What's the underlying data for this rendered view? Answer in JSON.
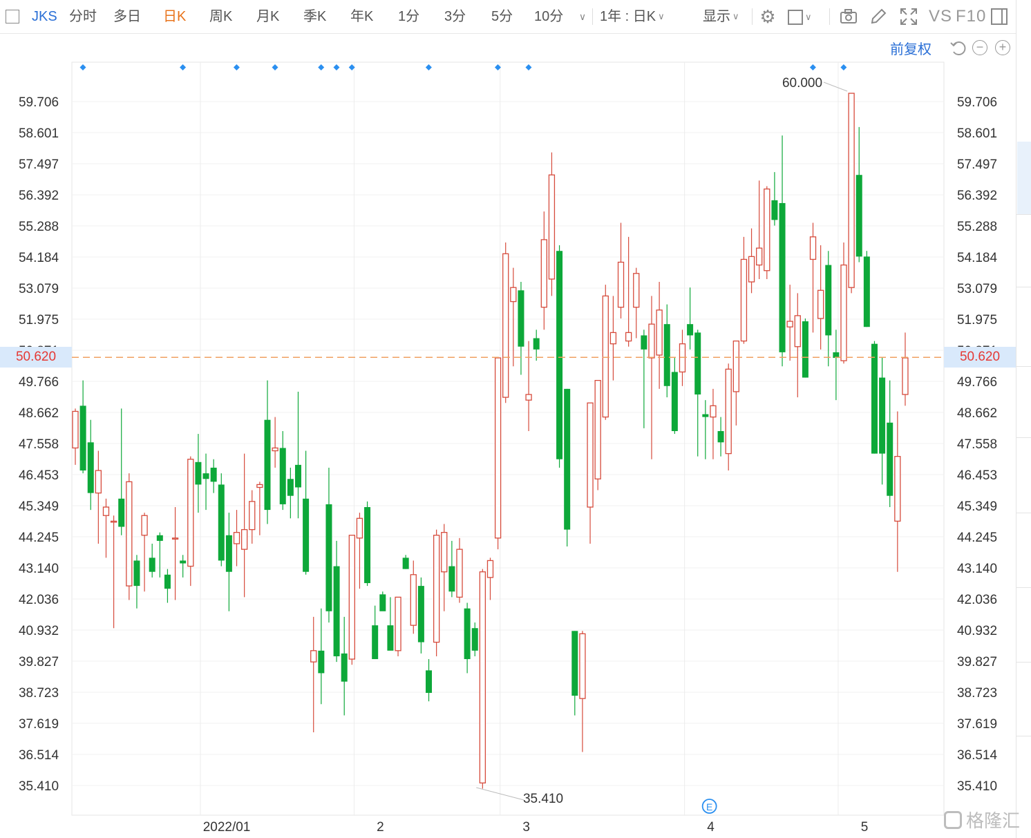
{
  "toolbar": {
    "symbol": "JKS",
    "periods": [
      "分时",
      "多日",
      "日K",
      "周K",
      "月K",
      "季K",
      "年K",
      "1分",
      "3分",
      "5分",
      "10分"
    ],
    "active_period": "日K",
    "range_label": "1年 : 日K",
    "display_label": "显示",
    "vs_label": "VS",
    "f10_label": "F10"
  },
  "subbar": {
    "adjust_label": "前复权"
  },
  "price_axis": {
    "ticks": [
      "59.706",
      "58.601",
      "57.497",
      "56.392",
      "55.288",
      "54.184",
      "53.079",
      "51.975",
      "50.871",
      "49.766",
      "48.662",
      "47.558",
      "46.453",
      "45.349",
      "44.245",
      "43.140",
      "42.036",
      "40.932",
      "39.827",
      "38.723",
      "37.619",
      "36.514",
      "35.410"
    ],
    "current_price": "50.620"
  },
  "time_axis": {
    "labels": [
      "2022/01",
      "2",
      "3",
      "4",
      "5"
    ]
  },
  "annotations": {
    "high_label": "60.000",
    "low_label": "35.410",
    "earnings_marker": "E"
  },
  "watermark": "格隆汇",
  "colors": {
    "up": "#d64a3b",
    "down": "#0da839",
    "accent": "#2a6fd6",
    "active": "#e8731a",
    "current_line": "#f0a060",
    "current_text": "#e53935"
  },
  "chart_data": {
    "type": "candlestick",
    "symbol": "JKS",
    "period": "daily",
    "candles": [
      {
        "o": 47.4,
        "h": 48.8,
        "l": 46.8,
        "c": 48.7
      },
      {
        "o": 48.9,
        "h": 49.8,
        "l": 46.5,
        "c": 46.6
      },
      {
        "o": 47.6,
        "h": 48.4,
        "l": 45.2,
        "c": 45.8
      },
      {
        "o": 45.8,
        "h": 47.3,
        "l": 44.0,
        "c": 46.6
      },
      {
        "o": 45.0,
        "h": 45.6,
        "l": 43.5,
        "c": 45.3
      },
      {
        "o": 44.8,
        "h": 45.0,
        "l": 41.0,
        "c": 44.8
      },
      {
        "o": 45.6,
        "h": 48.8,
        "l": 44.3,
        "c": 44.6
      },
      {
        "o": 42.5,
        "h": 46.5,
        "l": 42.0,
        "c": 46.2
      },
      {
        "o": 43.4,
        "h": 43.6,
        "l": 41.7,
        "c": 42.5
      },
      {
        "o": 44.3,
        "h": 45.1,
        "l": 42.3,
        "c": 45.0
      },
      {
        "o": 43.5,
        "h": 44.0,
        "l": 42.8,
        "c": 43.0
      },
      {
        "o": 44.3,
        "h": 44.4,
        "l": 42.8,
        "c": 44.1
      },
      {
        "o": 42.9,
        "h": 43.1,
        "l": 41.9,
        "c": 42.4
      },
      {
        "o": 44.2,
        "h": 45.3,
        "l": 42.0,
        "c": 44.2
      },
      {
        "o": 43.4,
        "h": 43.6,
        "l": 42.8,
        "c": 43.3
      },
      {
        "o": 43.2,
        "h": 47.1,
        "l": 42.5,
        "c": 47.0
      },
      {
        "o": 46.9,
        "h": 47.9,
        "l": 45.1,
        "c": 46.1
      },
      {
        "o": 46.5,
        "h": 47.2,
        "l": 45.2,
        "c": 46.3
      },
      {
        "o": 46.7,
        "h": 47.0,
        "l": 45.8,
        "c": 46.2
      },
      {
        "o": 46.1,
        "h": 46.5,
        "l": 43.2,
        "c": 43.4
      },
      {
        "o": 44.3,
        "h": 45.1,
        "l": 41.6,
        "c": 43.0
      },
      {
        "o": 44.0,
        "h": 45.2,
        "l": 43.2,
        "c": 44.4
      },
      {
        "o": 43.8,
        "h": 47.2,
        "l": 42.1,
        "c": 44.5
      },
      {
        "o": 44.5,
        "h": 45.9,
        "l": 44.0,
        "c": 45.5
      },
      {
        "o": 46.0,
        "h": 46.2,
        "l": 44.3,
        "c": 46.1
      },
      {
        "o": 48.4,
        "h": 49.8,
        "l": 44.7,
        "c": 45.2
      },
      {
        "o": 47.3,
        "h": 48.5,
        "l": 46.7,
        "c": 47.4
      },
      {
        "o": 47.4,
        "h": 48.0,
        "l": 45.2,
        "c": 45.4
      },
      {
        "o": 46.3,
        "h": 46.7,
        "l": 44.9,
        "c": 45.7
      },
      {
        "o": 46.8,
        "h": 49.4,
        "l": 44.9,
        "c": 46.0
      },
      {
        "o": 45.6,
        "h": 47.3,
        "l": 42.9,
        "c": 43.0
      },
      {
        "o": 39.8,
        "h": 41.4,
        "l": 37.3,
        "c": 40.2
      },
      {
        "o": 40.2,
        "h": 41.7,
        "l": 38.3,
        "c": 39.4
      },
      {
        "o": 45.4,
        "h": 46.7,
        "l": 41.2,
        "c": 41.6
      },
      {
        "o": 43.2,
        "h": 44.1,
        "l": 39.8,
        "c": 40.0
      },
      {
        "o": 40.1,
        "h": 41.4,
        "l": 37.9,
        "c": 39.1
      },
      {
        "o": 39.9,
        "h": 44.3,
        "l": 39.7,
        "c": 44.3
      },
      {
        "o": 44.2,
        "h": 45.1,
        "l": 42.4,
        "c": 44.9
      },
      {
        "o": 45.3,
        "h": 45.5,
        "l": 42.5,
        "c": 42.6
      },
      {
        "o": 41.1,
        "h": 41.8,
        "l": 39.9,
        "c": 39.9
      },
      {
        "o": 42.2,
        "h": 42.3,
        "l": 41.7,
        "c": 41.6
      },
      {
        "o": 41.1,
        "h": 42.1,
        "l": 40.3,
        "c": 40.2
      },
      {
        "o": 40.2,
        "h": 41.9,
        "l": 40.0,
        "c": 42.1
      },
      {
        "o": 43.5,
        "h": 43.6,
        "l": 43.1,
        "c": 43.1
      },
      {
        "o": 41.1,
        "h": 43.4,
        "l": 40.8,
        "c": 42.9
      },
      {
        "o": 42.5,
        "h": 42.8,
        "l": 40.1,
        "c": 40.5
      },
      {
        "o": 39.5,
        "h": 39.9,
        "l": 38.4,
        "c": 38.7
      },
      {
        "o": 40.5,
        "h": 44.5,
        "l": 40.0,
        "c": 44.3
      },
      {
        "o": 43.0,
        "h": 44.7,
        "l": 41.6,
        "c": 44.4
      },
      {
        "o": 43.2,
        "h": 44.1,
        "l": 42.1,
        "c": 42.3
      },
      {
        "o": 42.1,
        "h": 44.2,
        "l": 41.9,
        "c": 43.8
      },
      {
        "o": 41.7,
        "h": 41.9,
        "l": 39.4,
        "c": 39.9
      },
      {
        "o": 41.0,
        "h": 41.2,
        "l": 40.0,
        "c": 40.2
      },
      {
        "o": 35.5,
        "h": 43.1,
        "l": 35.3,
        "c": 43.0
      },
      {
        "o": 42.8,
        "h": 43.5,
        "l": 42.0,
        "c": 43.4
      },
      {
        "o": 44.2,
        "h": 50.6,
        "l": 43.8,
        "c": 50.6
      },
      {
        "o": 49.2,
        "h": 54.7,
        "l": 49.0,
        "c": 54.3
      },
      {
        "o": 52.6,
        "h": 53.8,
        "l": 50.3,
        "c": 53.1
      },
      {
        "o": 53.0,
        "h": 53.3,
        "l": 50.0,
        "c": 51.0
      },
      {
        "o": 49.1,
        "h": 51.2,
        "l": 48.0,
        "c": 49.3
      },
      {
        "o": 51.3,
        "h": 51.6,
        "l": 50.5,
        "c": 50.9
      },
      {
        "o": 52.4,
        "h": 55.8,
        "l": 51.6,
        "c": 54.8
      },
      {
        "o": 53.4,
        "h": 57.9,
        "l": 52.8,
        "c": 57.1
      },
      {
        "o": 54.4,
        "h": 54.6,
        "l": 46.7,
        "c": 47.0
      },
      {
        "o": 49.5,
        "h": 49.5,
        "l": 43.9,
        "c": 44.5
      },
      {
        "o": 40.9,
        "h": 40.9,
        "l": 37.9,
        "c": 38.6
      },
      {
        "o": 38.5,
        "h": 40.9,
        "l": 36.6,
        "c": 40.8
      },
      {
        "o": 45.3,
        "h": 49.0,
        "l": 44.0,
        "c": 49.0
      },
      {
        "o": 46.3,
        "h": 49.8,
        "l": 45.9,
        "c": 49.8
      },
      {
        "o": 48.5,
        "h": 53.2,
        "l": 48.4,
        "c": 52.8
      },
      {
        "o": 51.1,
        "h": 52.8,
        "l": 49.8,
        "c": 51.5
      },
      {
        "o": 52.4,
        "h": 55.4,
        "l": 52.0,
        "c": 54.0
      },
      {
        "o": 51.2,
        "h": 54.9,
        "l": 51.0,
        "c": 51.5
      },
      {
        "o": 52.4,
        "h": 53.8,
        "l": 51.3,
        "c": 53.6
      },
      {
        "o": 51.4,
        "h": 51.6,
        "l": 48.1,
        "c": 50.9
      },
      {
        "o": 50.6,
        "h": 52.8,
        "l": 47.0,
        "c": 51.8
      },
      {
        "o": 50.7,
        "h": 53.3,
        "l": 49.5,
        "c": 52.3
      },
      {
        "o": 51.8,
        "h": 52.5,
        "l": 49.2,
        "c": 49.6
      },
      {
        "o": 50.1,
        "h": 50.6,
        "l": 47.9,
        "c": 48.0
      },
      {
        "o": 50.1,
        "h": 51.6,
        "l": 49.6,
        "c": 51.1
      },
      {
        "o": 51.8,
        "h": 53.1,
        "l": 50.9,
        "c": 51.4
      },
      {
        "o": 51.5,
        "h": 51.6,
        "l": 47.1,
        "c": 49.3
      },
      {
        "o": 48.6,
        "h": 49.1,
        "l": 47.0,
        "c": 48.5
      },
      {
        "o": 48.5,
        "h": 49.5,
        "l": 47.0,
        "c": 48.9
      },
      {
        "o": 48.0,
        "h": 48.5,
        "l": 47.1,
        "c": 47.6
      },
      {
        "o": 47.2,
        "h": 50.4,
        "l": 46.6,
        "c": 50.2
      },
      {
        "o": 49.4,
        "h": 51.1,
        "l": 48.2,
        "c": 51.2
      },
      {
        "o": 51.2,
        "h": 54.9,
        "l": 51.1,
        "c": 54.1
      },
      {
        "o": 53.3,
        "h": 55.2,
        "l": 52.9,
        "c": 54.2
      },
      {
        "o": 53.9,
        "h": 56.9,
        "l": 53.4,
        "c": 54.5
      },
      {
        "o": 53.7,
        "h": 56.7,
        "l": 53.4,
        "c": 56.6
      },
      {
        "o": 56.2,
        "h": 57.2,
        "l": 55.3,
        "c": 55.5
      },
      {
        "o": 56.1,
        "h": 58.5,
        "l": 50.3,
        "c": 50.8
      },
      {
        "o": 51.7,
        "h": 53.2,
        "l": 50.5,
        "c": 51.9
      },
      {
        "o": 51.0,
        "h": 52.9,
        "l": 49.2,
        "c": 52.1
      },
      {
        "o": 51.9,
        "h": 52.0,
        "l": 49.9,
        "c": 49.9
      },
      {
        "o": 54.1,
        "h": 55.4,
        "l": 51.5,
        "c": 54.9
      },
      {
        "o": 52.0,
        "h": 54.6,
        "l": 50.9,
        "c": 53.0
      },
      {
        "o": 53.9,
        "h": 54.4,
        "l": 50.3,
        "c": 51.4
      },
      {
        "o": 50.8,
        "h": 51.6,
        "l": 49.1,
        "c": 50.6
      },
      {
        "o": 50.5,
        "h": 54.7,
        "l": 50.4,
        "c": 53.9
      },
      {
        "o": 53.1,
        "h": 60.0,
        "l": 52.9,
        "c": 60.0
      },
      {
        "o": 57.1,
        "h": 58.8,
        "l": 54.0,
        "c": 54.2
      },
      {
        "o": 54.2,
        "h": 54.4,
        "l": 51.7,
        "c": 51.7
      },
      {
        "o": 51.1,
        "h": 51.2,
        "l": 47.2,
        "c": 47.2
      },
      {
        "o": 49.9,
        "h": 50.6,
        "l": 46.1,
        "c": 47.2
      },
      {
        "o": 48.3,
        "h": 49.8,
        "l": 45.3,
        "c": 45.7
      },
      {
        "o": 44.8,
        "h": 48.7,
        "l": 43.0,
        "c": 47.1
      },
      {
        "o": 49.3,
        "h": 51.5,
        "l": 48.9,
        "c": 50.6
      }
    ],
    "events_at_index": [
      0,
      13,
      20,
      25,
      31,
      33,
      35,
      45,
      54,
      58,
      95,
      99
    ],
    "y_ticks": [
      59.706,
      58.601,
      57.497,
      56.392,
      55.288,
      54.184,
      53.079,
      51.975,
      50.871,
      49.766,
      48.662,
      47.558,
      46.453,
      45.349,
      44.245,
      43.14,
      42.036,
      40.932,
      39.827,
      38.723,
      37.619,
      36.514,
      35.41
    ],
    "x_labels": [
      {
        "label": "2022/01",
        "index": 17
      },
      {
        "label": "2",
        "index": 37
      },
      {
        "label": "3",
        "index": 56
      },
      {
        "label": "4",
        "index": 80
      },
      {
        "label": "5",
        "index": 100
      }
    ],
    "current_price": 50.62,
    "high": 60.0,
    "low": 35.41,
    "high_index": 101,
    "low_index": 52,
    "earnings_index": 72,
    "grid": true
  }
}
